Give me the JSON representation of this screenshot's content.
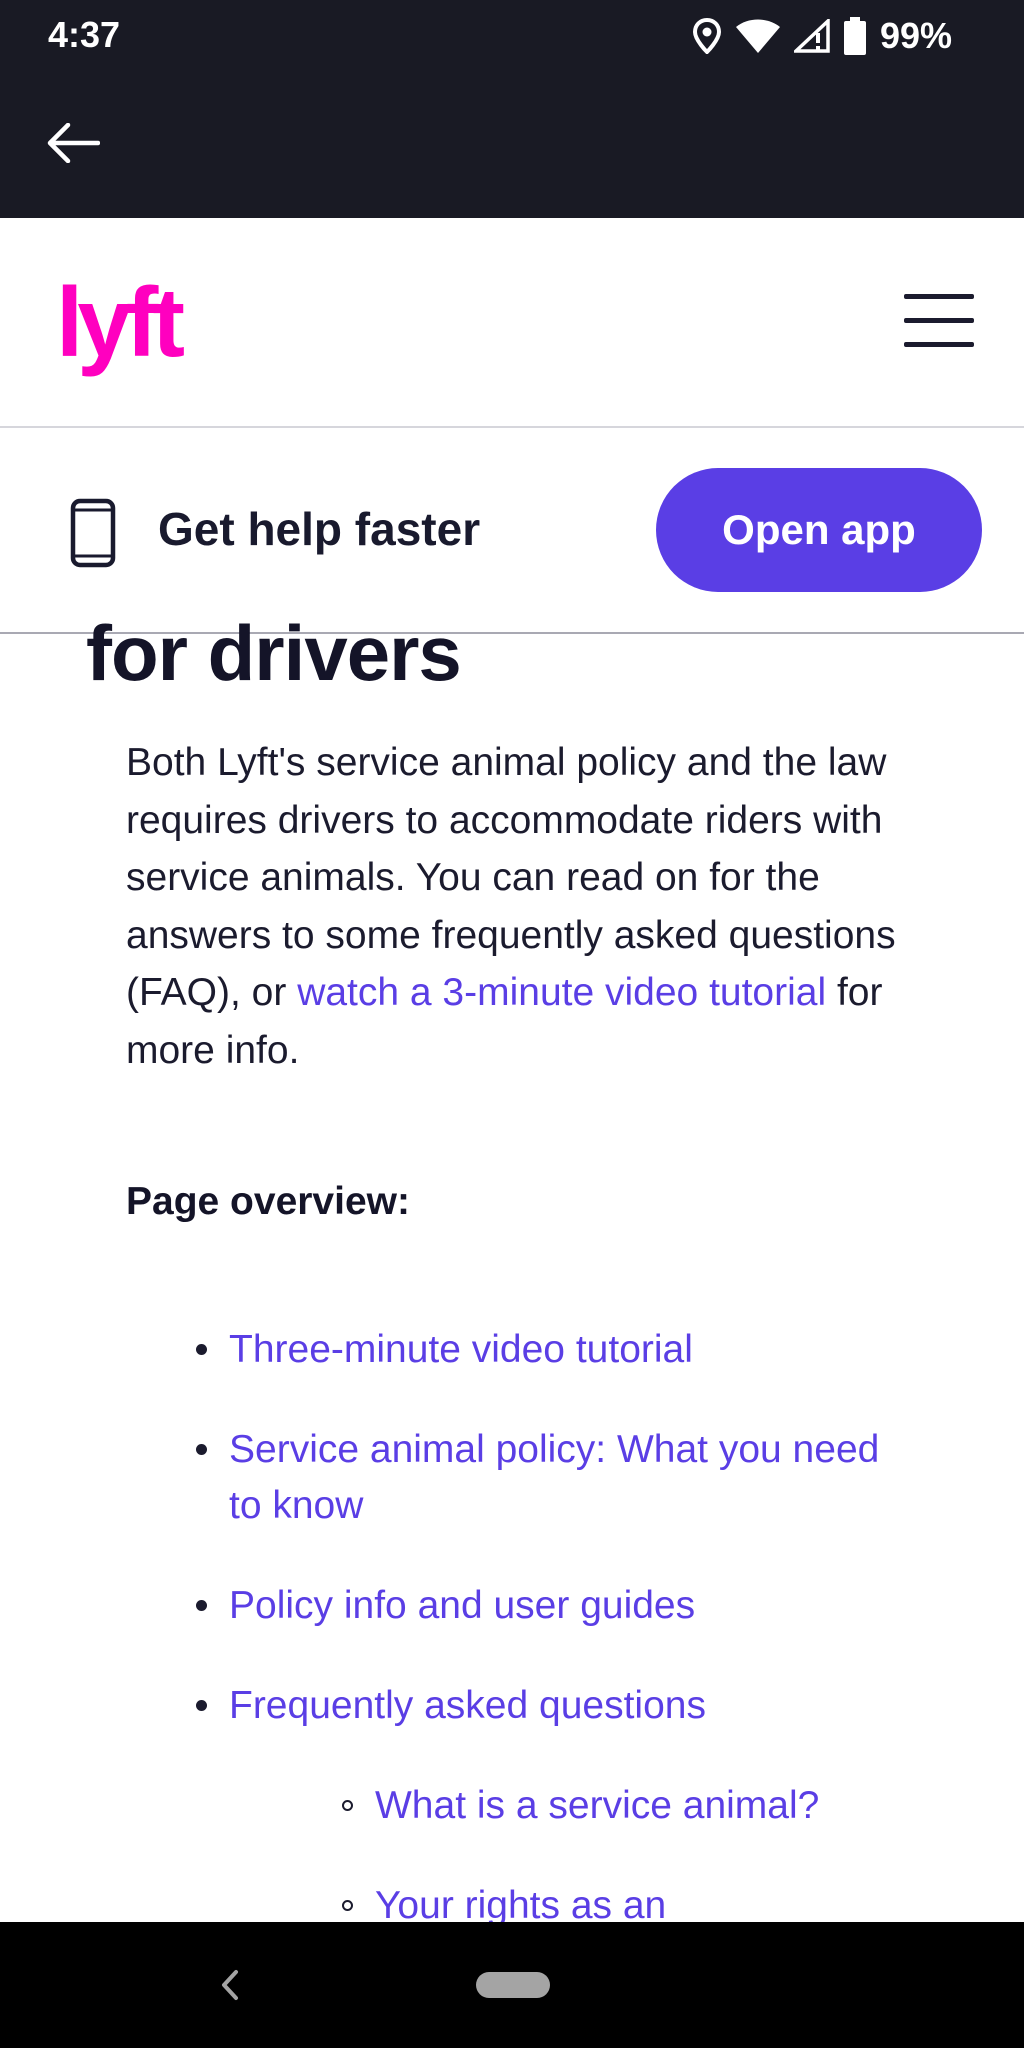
{
  "status_bar": {
    "time": "4:37",
    "battery": "99%",
    "icons": [
      "location-icon",
      "wifi-icon",
      "signal-icon",
      "battery-icon"
    ]
  },
  "app_bar": {
    "back_icon": "arrow-left-icon"
  },
  "header": {
    "logo_text": "lyft",
    "logo_color": "#ff00bf",
    "menu_icon": "hamburger-menu-icon"
  },
  "help_banner": {
    "icon": "phone-icon",
    "text": "Get help faster",
    "button_label": "Open app",
    "button_color": "#5a3ee5"
  },
  "main": {
    "heading": "for drivers",
    "intro_part1": "Both Lyft's service animal policy and the law requires drivers to accommodate riders with service animals. You can read on for the answers to some frequently asked questions (FAQ), or",
    "intro_link": "watch a 3-minute video tutorial",
    "intro_part2": "for more info.",
    "overview_title": "Page overview:",
    "overview_items": [
      {
        "label": "Three-minute video tutorial",
        "level": 1
      },
      {
        "label": "Service animal policy: What you need to know",
        "level": 1
      },
      {
        "label": "Policy info and user guides",
        "level": 1
      },
      {
        "label": "Frequently asked questions",
        "level": 1
      },
      {
        "label": "What is a service animal?",
        "level": 2
      },
      {
        "label": "Your rights as an",
        "level": 2
      }
    ],
    "link_color": "#5a3ee5"
  },
  "nav_bar": {
    "back_icon": "chevron-left-icon",
    "home_icon": "home-pill-icon"
  }
}
